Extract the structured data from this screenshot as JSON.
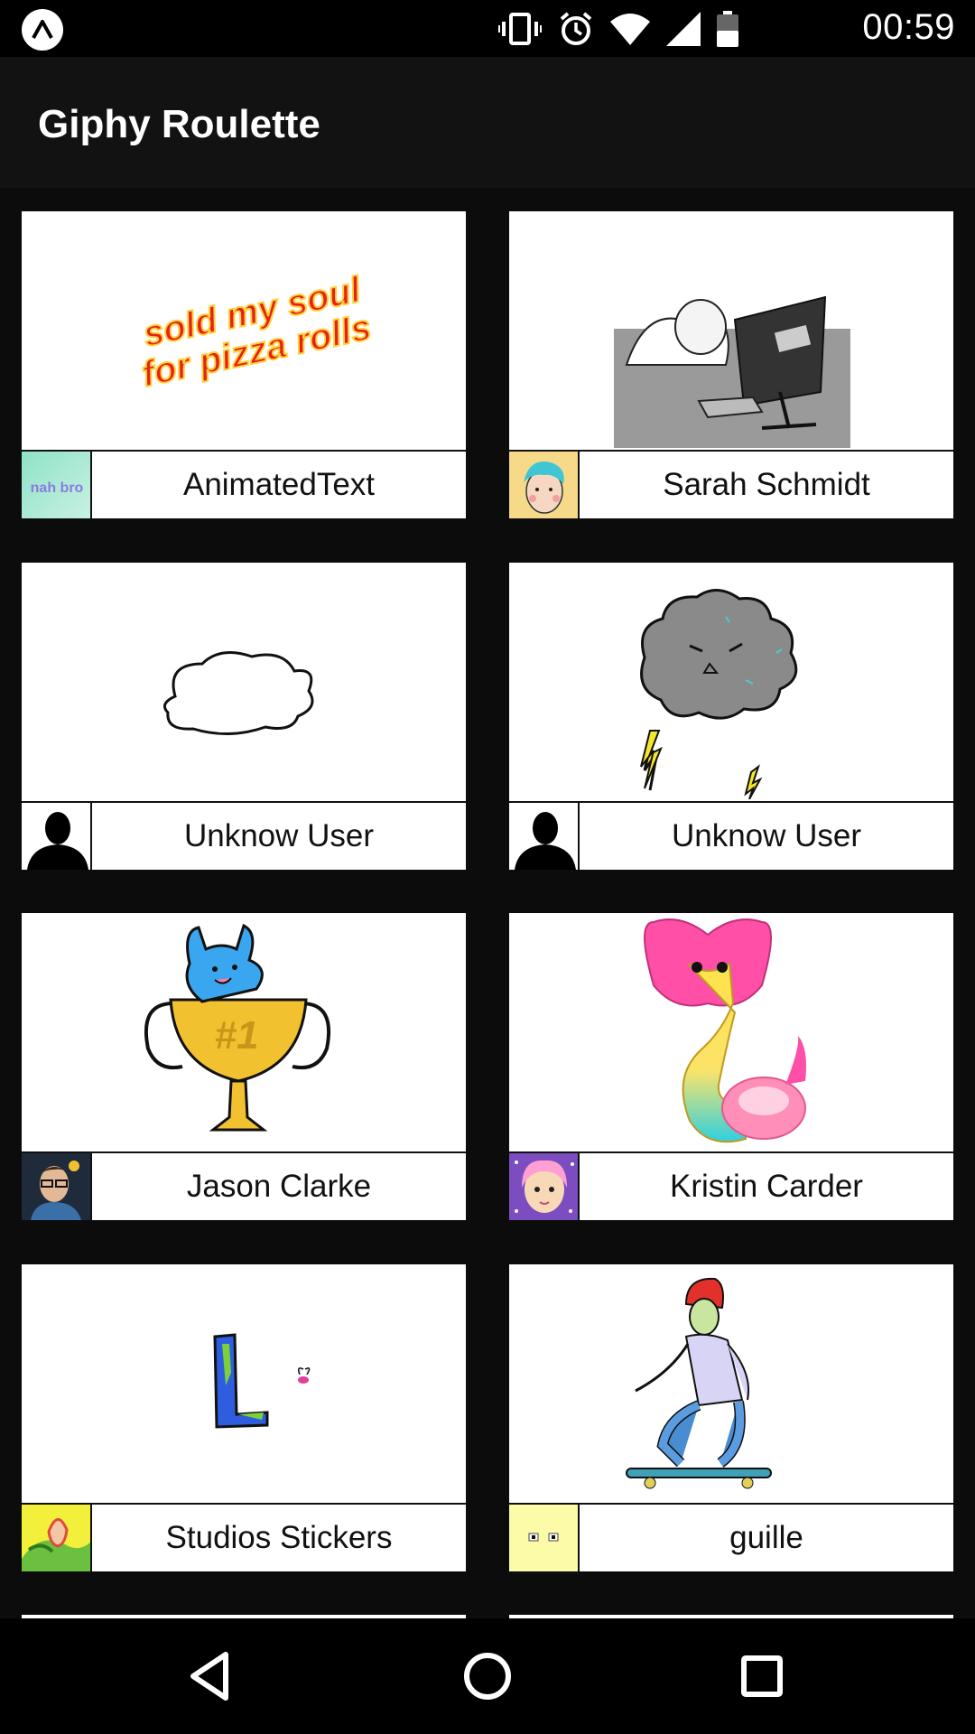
{
  "status_bar": {
    "time": "00:59",
    "icons": [
      "app-notification-icon",
      "vibrate-icon",
      "alarm-icon",
      "wifi-icon",
      "signal-icon",
      "battery-icon"
    ]
  },
  "app_bar": {
    "title": "Giphy Roulette"
  },
  "cards": [
    {
      "name": "AnimatedText",
      "gif": "sold my soul for pizza rolls text",
      "gif_text_1": "sold my soul",
      "gif_text_2": "for pizza rolls",
      "avatar_text": "nah bro"
    },
    {
      "name": "Sarah Schmidt",
      "gif": "person asleep at computer"
    },
    {
      "name": "Unknow User",
      "gif": "white cloud outline"
    },
    {
      "name": "Unknow User",
      "gif": "grumpy grey storm cloud with lightning"
    },
    {
      "name": "Jason Clarke",
      "gif": "blue cat on #1 trophy",
      "gif_text": "#1"
    },
    {
      "name": "Kristin Carder",
      "gif": "pink and yellow cobra"
    },
    {
      "name": "Studios Stickers",
      "gif": "blue letter L with fly"
    },
    {
      "name": "guille",
      "gif": "skateboarding man with red beanie"
    }
  ],
  "colors": {
    "background": "#0c0c0c",
    "app_bar": "#121212",
    "card": "#ffffff",
    "text": "#111111"
  },
  "nav_bar": {
    "icons": [
      "back-icon",
      "home-icon",
      "recents-icon"
    ]
  }
}
